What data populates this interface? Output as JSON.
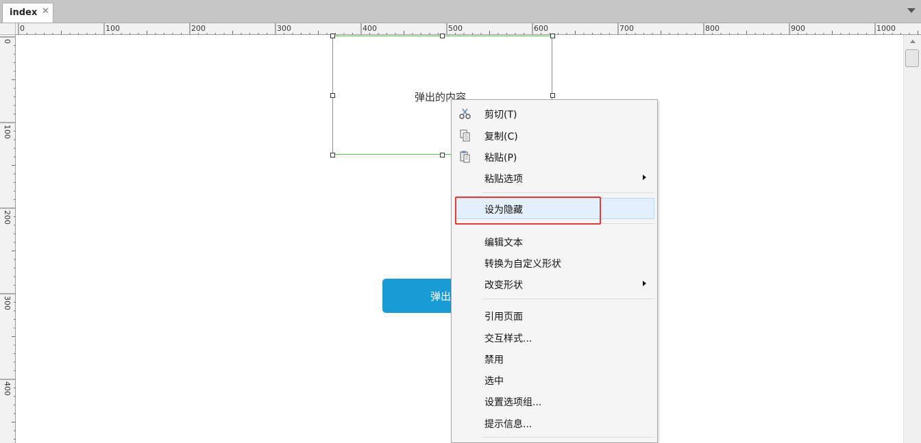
{
  "tab": {
    "label": "index",
    "close": "✕"
  },
  "ruler": {
    "top": [
      "0",
      "100",
      "200",
      "300",
      "400",
      "500",
      "600",
      "700",
      "800",
      "900",
      "1000"
    ],
    "left": [
      "0",
      "100",
      "200",
      "300",
      "400"
    ]
  },
  "canvas": {
    "popup_text": "弹出的内容",
    "button_label": "弹出"
  },
  "context_menu": {
    "items": [
      {
        "label": "剪切(T)",
        "icon": "scissors-icon"
      },
      {
        "label": "复制(C)",
        "icon": "copy-icon"
      },
      {
        "label": "粘贴(P)",
        "icon": "paste-icon"
      },
      {
        "label": "粘贴选项",
        "submenu": true
      },
      {
        "label": "设为隐藏",
        "hovered": true
      },
      {
        "label": "编辑文本"
      },
      {
        "label": "转换为自定义形状"
      },
      {
        "label": "改变形状",
        "submenu": true
      },
      {
        "label": "引用页面"
      },
      {
        "label": "交互样式..."
      },
      {
        "label": "禁用"
      },
      {
        "label": "选中"
      },
      {
        "label": "设置选项组..."
      },
      {
        "label": "提示信息..."
      }
    ]
  },
  "colors": {
    "selection_border": "#4bc34b",
    "button_fill": "#199bd6",
    "annotation_box": "#e53935",
    "menu_hover": "#e3f0fb"
  }
}
